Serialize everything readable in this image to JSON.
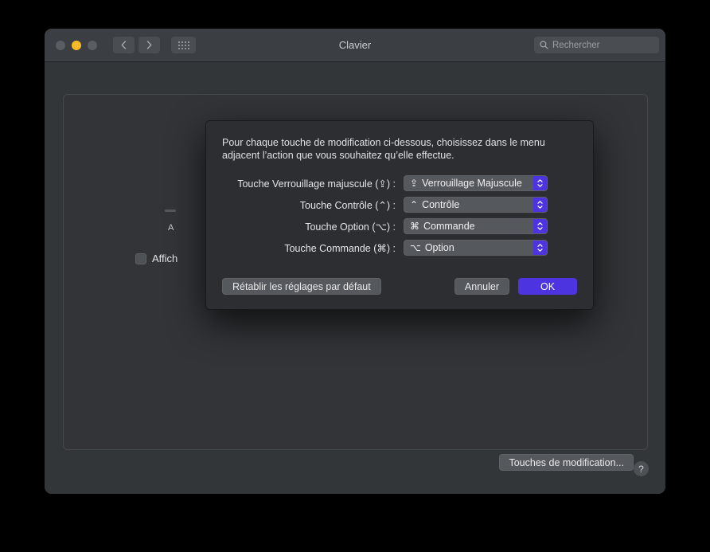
{
  "window": {
    "title": "Clavier",
    "traffic_lights": [
      "close",
      "minimize",
      "zoom"
    ],
    "nav": {
      "back": "back-icon",
      "forward": "forward-icon",
      "grid": "show-all-icon"
    },
    "search": {
      "placeholder": "Rechercher",
      "value": "",
      "icon": "search-icon"
    }
  },
  "background_pane": {
    "letter_fragment": "A",
    "checkbox": {
      "label": "Affich",
      "checked": false
    },
    "modifier_keys_button": "Touches de modification...",
    "help_button": "?"
  },
  "dialog": {
    "description": "Pour chaque touche de modification ci-dessous, choisissez dans le menu adjacent l’action que vous souhaitez qu’elle effectue.",
    "rows": [
      {
        "label": "Touche Verrouillage majuscule (⇪) :",
        "glyph": "⇪",
        "value": "Verrouillage Majuscule"
      },
      {
        "label": "Touche Contrôle (⌃) :",
        "glyph": "⌃",
        "value": "Contrôle"
      },
      {
        "label": "Touche Option (⌥) :",
        "glyph": "⌘",
        "value": "Commande"
      },
      {
        "label": "Touche Commande (⌘) :",
        "glyph": "⌥",
        "value": "Option"
      }
    ],
    "buttons": {
      "reset": "Rétablir les réglages par défaut",
      "cancel": "Annuler",
      "ok": "OK"
    }
  },
  "colors": {
    "accent": "#4c34e0",
    "window_bg": "#333639",
    "titlebar_bg": "#3b3e42",
    "dialog_bg": "#2c2e31",
    "control_bg": "#55585c",
    "traffic_yellow": "#f6ba26"
  }
}
